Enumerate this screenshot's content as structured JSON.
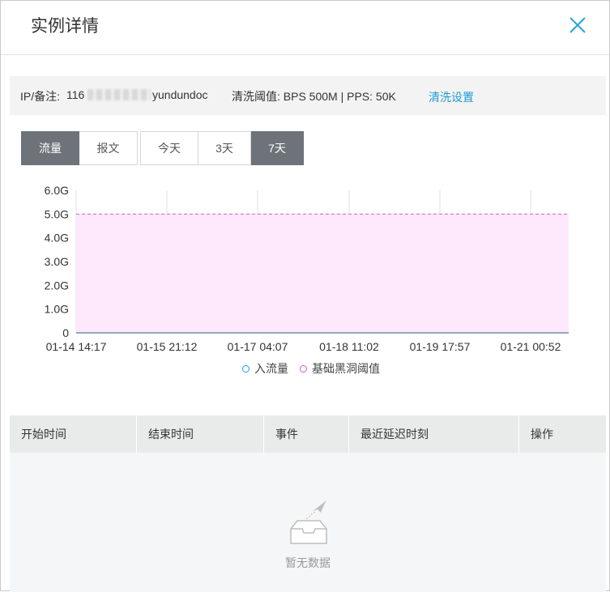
{
  "dialog": {
    "title": "实例详情"
  },
  "info": {
    "ip_label": "IP/备注:",
    "ip_prefix": "116",
    "ip_suffix": "yundundoc",
    "threshold": "清洗阈值: BPS 500M | PPS: 50K",
    "clean_link": "清洗设置"
  },
  "metric_tabs": [
    {
      "label": "流量",
      "active": true
    },
    {
      "label": "报文",
      "active": false
    }
  ],
  "range_tabs": [
    {
      "label": "今天",
      "active": false
    },
    {
      "label": "3天",
      "active": false
    },
    {
      "label": "7天",
      "active": true
    }
  ],
  "chart_data": {
    "type": "area",
    "y_ticks": [
      "6.0G",
      "5.0G",
      "4.0G",
      "3.0G",
      "2.0G",
      "1.0G",
      "0"
    ],
    "x_ticks": [
      "01-14 14:17",
      "01-15 21:12",
      "01-17 04:07",
      "01-18 11:02",
      "01-19 17:57",
      "01-21 00:52"
    ],
    "ylim": [
      0,
      6
    ],
    "y_unit": "G",
    "series": [
      {
        "name": "入流量",
        "values": [
          0,
          0,
          0,
          0,
          0,
          0
        ],
        "color": "#1f7dd6"
      },
      {
        "name": "基础黑洞阈值",
        "values": [
          5,
          5,
          5,
          5,
          5,
          5
        ],
        "color": "#d35ad3",
        "fill": "#fde8fc",
        "dashed": true
      }
    ],
    "legend_position": "bottom-center",
    "grid": "vertical"
  },
  "table": {
    "columns": [
      "开始时间",
      "结束时间",
      "事件",
      "最近延迟时刻",
      "操作"
    ],
    "empty_text": "暂无数据"
  }
}
